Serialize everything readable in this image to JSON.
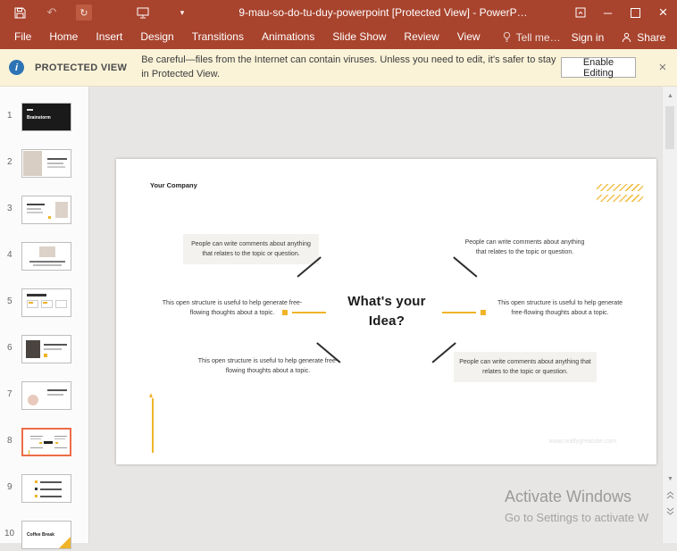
{
  "titlebar": {
    "title": "9-mau-so-do-tu-duy-powerpoint [Protected View] - PowerP…"
  },
  "icons": {
    "undo": "↶",
    "repeat": "↻",
    "qat_dropdown": "▾",
    "minimize": "─",
    "close": "×",
    "info": "i",
    "bar_close": "×",
    "scroll_up": "▲",
    "scroll_down": "▼"
  },
  "ribbon": {
    "tabs": [
      "File",
      "Home",
      "Insert",
      "Design",
      "Transitions",
      "Animations",
      "Slide Show",
      "Review",
      "View"
    ],
    "tell_me": "Tell me…",
    "sign_in": "Sign in",
    "share": "Share"
  },
  "protected_view": {
    "label": "PROTECTED VIEW",
    "message": "Be careful—files from the Internet can contain viruses. Unless you need to edit, it's safer to stay in Protected View.",
    "enable_button": "Enable Editing"
  },
  "slides_panel": {
    "selected_number": "8",
    "items": [
      {
        "number": "1",
        "caption": "Brainstorm"
      },
      {
        "number": "2"
      },
      {
        "number": "3"
      },
      {
        "number": "4"
      },
      {
        "number": "5"
      },
      {
        "number": "6"
      },
      {
        "number": "7"
      },
      {
        "number": "8"
      },
      {
        "number": "9"
      },
      {
        "number": "10",
        "caption": "Coffee Break"
      }
    ]
  },
  "slide": {
    "company": "Your Company",
    "title_line1": "What's your",
    "title_line2": "Idea?",
    "comment_text": "People can write comments about anything that relates to the topic or question.",
    "structure_text": "This open structure is useful to help generate free-flowing thoughts about a topic.",
    "watermark": "www.reallygreatsite.com"
  },
  "os_watermark": {
    "line1": "Activate Windows",
    "line2": "Go to Settings to activate W"
  },
  "colors": {
    "titlebar_red": "#A8432D",
    "accent_yellow": "#F0B429",
    "selection_orange": "#ED6C47",
    "protected_bar_bg": "#FAF3D8",
    "info_blue": "#2E74B5"
  }
}
